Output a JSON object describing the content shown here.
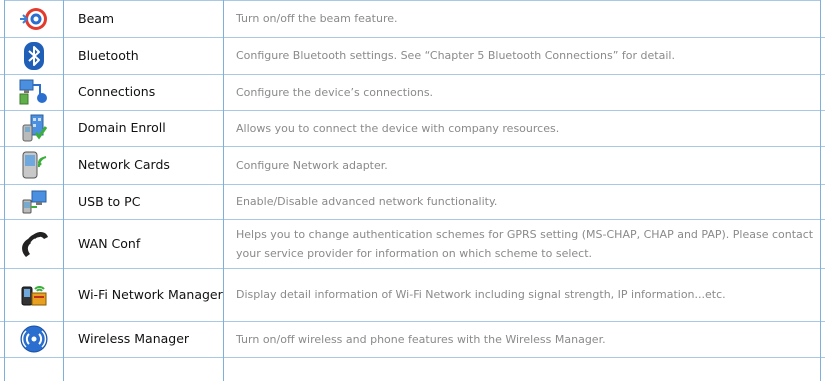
{
  "rows": [
    {
      "icon": "beam-target-icon",
      "name": "Beam",
      "desc": "Turn on/off the beam feature."
    },
    {
      "icon": "bluetooth-icon",
      "name": "Bluetooth",
      "desc": "Configure Bluetooth settings. See “Chapter 5 Bluetooth Connections” for detail."
    },
    {
      "icon": "connections-icon",
      "name": "Connections",
      "desc": "Configure the device’s connections."
    },
    {
      "icon": "domain-enroll-icon",
      "name": "Domain Enroll",
      "desc": "Allows you to connect the device with company resources."
    },
    {
      "icon": "network-cards-icon",
      "name": "Network Cards",
      "desc": "Configure Network adapter."
    },
    {
      "icon": "usb-to-pc-icon",
      "name": "USB to PC",
      "desc": "Enable/Disable advanced network functionality."
    },
    {
      "icon": "wan-phone-icon",
      "name": "WAN Conf",
      "desc": "Helps you to change authentication schemes for GPRS setting (MS-CHAP, CHAP and PAP). Please contact your service provider for information on which scheme to select."
    },
    {
      "icon": "wifi-manager-icon",
      "name": "Wi-Fi Network Manager",
      "desc": "Display detail information of Wi-Fi Network including signal strength, IP information...etc."
    },
    {
      "icon": "wireless-manager-icon",
      "name": "Wireless Manager",
      "desc": "Turn on/off wireless and phone features with the Wireless Manager."
    }
  ],
  "colors": {
    "border": "#7fb0dc",
    "name_text": "#111111",
    "desc_text": "#8a8a8a"
  }
}
